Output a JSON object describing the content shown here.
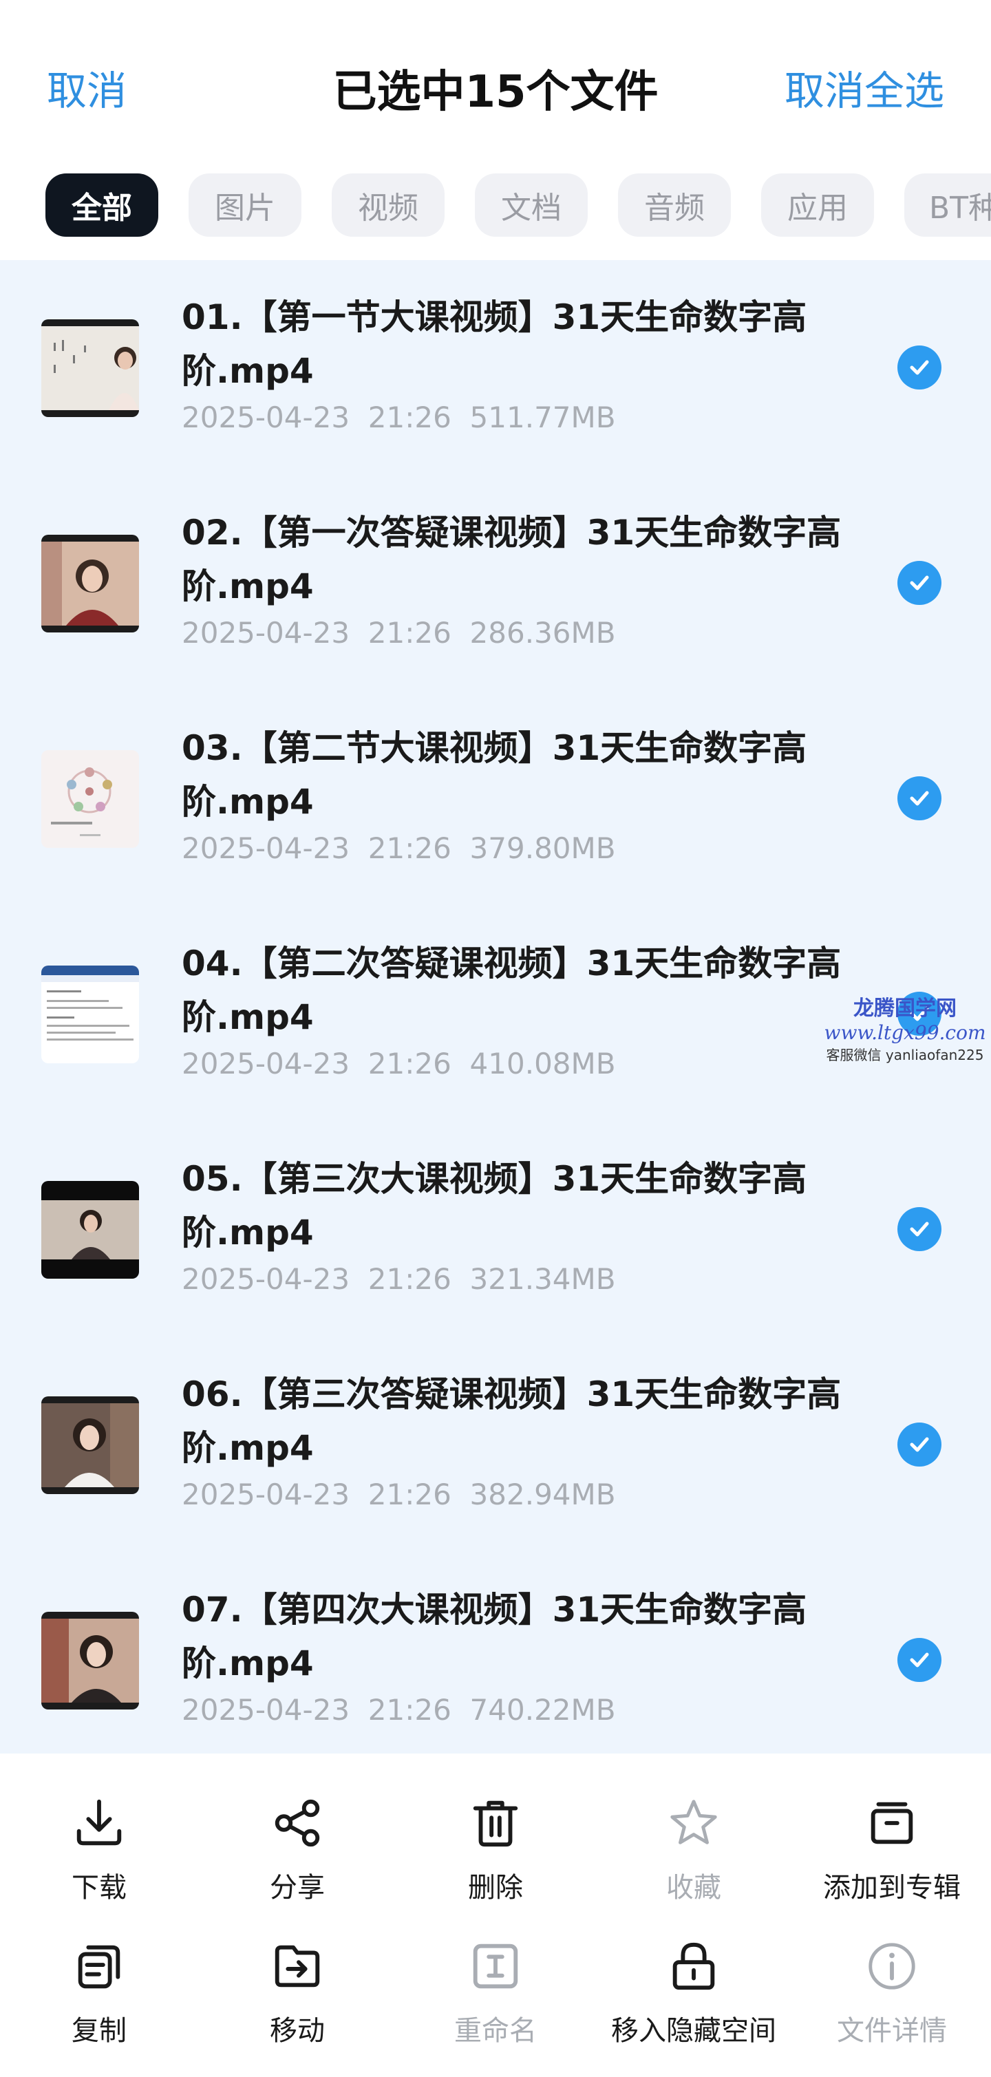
{
  "header": {
    "cancel": "取消",
    "title": "已选中15个文件",
    "deselect_all": "取消全选"
  },
  "categories": [
    "全部",
    "图片",
    "视频",
    "文档",
    "音频",
    "应用",
    "BT种"
  ],
  "files": [
    {
      "name": "01.【第一节大课视频】31天生命数字高阶.mp4",
      "date": "2025-04-23",
      "time": "21:26",
      "size": "511.77MB"
    },
    {
      "name": "02.【第一次答疑课视频】31天生命数字高阶.mp4",
      "date": "2025-04-23",
      "time": "21:26",
      "size": "286.36MB"
    },
    {
      "name": "03.【第二节大课视频】31天生命数字高阶.mp4",
      "date": "2025-04-23",
      "time": "21:26",
      "size": "379.80MB"
    },
    {
      "name": "04.【第二次答疑课视频】31天生命数字高阶.mp4",
      "date": "2025-04-23",
      "time": "21:26",
      "size": "410.08MB"
    },
    {
      "name": "05.【第三次大课视频】31天生命数字高阶.mp4",
      "date": "2025-04-23",
      "time": "21:26",
      "size": "321.34MB"
    },
    {
      "name": "06.【第三次答疑课视频】31天生命数字高阶.mp4",
      "date": "2025-04-23",
      "time": "21:26",
      "size": "382.94MB"
    },
    {
      "name": "07.【第四次大课视频】31天生命数字高阶.mp4",
      "date": "2025-04-23",
      "time": "21:26",
      "size": "740.22MB"
    }
  ],
  "watermark": {
    "line1": "龙腾国学网",
    "line2": "www.ltgx99.com",
    "line3": "客服微信 yanliaofan225"
  },
  "toolbar": [
    {
      "label": "下载",
      "icon": "download-icon",
      "enabled": true
    },
    {
      "label": "分享",
      "icon": "share-icon",
      "enabled": true
    },
    {
      "label": "删除",
      "icon": "trash-icon",
      "enabled": true
    },
    {
      "label": "收藏",
      "icon": "star-icon",
      "enabled": false
    },
    {
      "label": "添加到专辑",
      "icon": "album-icon",
      "enabled": true
    },
    {
      "label": "复制",
      "icon": "copy-icon",
      "enabled": true
    },
    {
      "label": "移动",
      "icon": "move-folder-icon",
      "enabled": true
    },
    {
      "label": "重命名",
      "icon": "rename-icon",
      "enabled": false
    },
    {
      "label": "移入隐藏空间",
      "icon": "lock-icon",
      "enabled": true
    },
    {
      "label": "文件详情",
      "icon": "info-icon",
      "enabled": false
    }
  ],
  "colors": {
    "accent": "#2f8fe0",
    "check": "#2d9cf0",
    "list_bg": "#eef5fd",
    "chip_active": "#0f1620",
    "meta_text": "#a9adb3"
  }
}
